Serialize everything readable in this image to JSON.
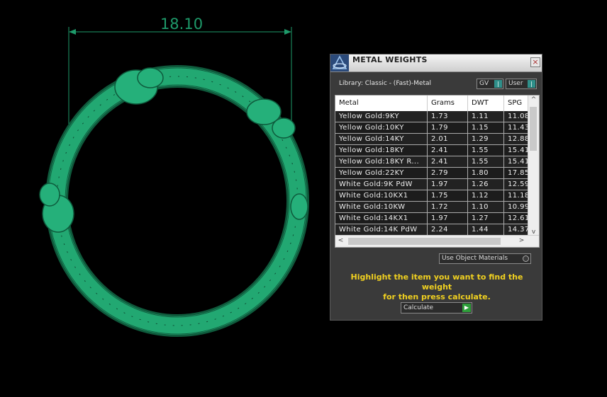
{
  "viewport": {
    "dimension_label": "18.10",
    "ring_color": "#1e9a6a",
    "dimension_color": "#1e9a6a"
  },
  "panel": {
    "title": "METAL WEIGHTS",
    "close_glyph": "×",
    "library_label": "Library: Classic - (Fast)-Metal",
    "gv_toggle": {
      "label": "GV",
      "knob": "|"
    },
    "user_toggle": {
      "label": "User",
      "knob": "|"
    },
    "table": {
      "headers": [
        "Metal",
        "Grams",
        "DWT",
        "SPG"
      ],
      "rows": [
        [
          "Yellow Gold:9KY",
          "1.73",
          "1.11",
          "11.08"
        ],
        [
          "Yellow Gold:10KY",
          "1.79",
          "1.15",
          "11.43"
        ],
        [
          "Yellow Gold:14KY",
          "2.01",
          "1.29",
          "12.88"
        ],
        [
          "Yellow Gold:18KY",
          "2.41",
          "1.55",
          "15.41"
        ],
        [
          "Yellow Gold:18KY R...",
          "2.41",
          "1.55",
          "15.41"
        ],
        [
          "Yellow Gold:22KY",
          "2.79",
          "1.80",
          "17.85"
        ],
        [
          "White Gold:9K PdW",
          "1.97",
          "1.26",
          "12.59"
        ],
        [
          "White Gold:10KX1",
          "1.75",
          "1.12",
          "11.18"
        ],
        [
          "White Gold:10KW",
          "1.72",
          "1.10",
          "10.99"
        ],
        [
          "White Gold:14KX1",
          "1.97",
          "1.27",
          "12.61"
        ],
        [
          "White Gold:14K PdW",
          "2.24",
          "1.44",
          "14.37"
        ]
      ],
      "scroll_up": "^",
      "scroll_down": "v",
      "scroll_left": "<",
      "scroll_right": ">"
    },
    "use_object_materials_label": "Use Object Materials",
    "hint_line1": "Highlight the item you want to find the weight",
    "hint_line2": "for then press calculate.",
    "calculate_label": "Calculate",
    "calculate_glyph": "▶"
  }
}
